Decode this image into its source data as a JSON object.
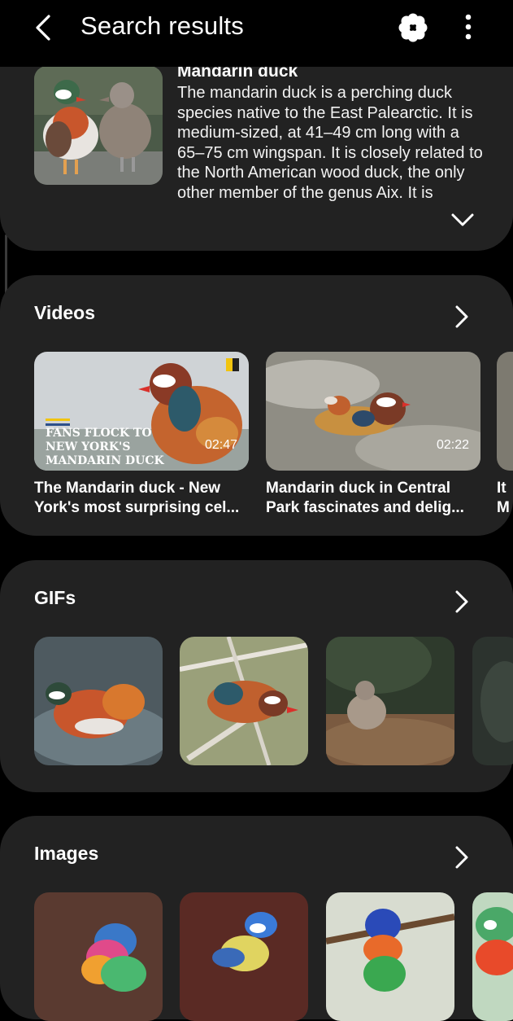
{
  "header": {
    "title": "Search results",
    "back_icon": "chevron-left-icon",
    "bixby_icon": "bixby-vision-icon",
    "more_icon": "more-vertical-icon"
  },
  "wiki": {
    "title": "Mandarin duck",
    "text": "The mandarin duck is a perching duck species native to the East Palearctic. It is medium-sized, at 41–49 cm long with a 65–75 cm wingspan. It is closely related to the North American wood duck, the only other member of the genus Aix. It is monotypic. Outside",
    "expand_icon": "chevron-down-icon"
  },
  "videos": {
    "title": "Videos",
    "items": [
      {
        "overlay_text": [
          "FANS FLOCK TO",
          "NEW YORK'S",
          "MANDARIN DUCK"
        ],
        "duration": "02:47",
        "caption_line1": "The Mandarin duck - New",
        "caption_line2": "York's most surprising cel..."
      },
      {
        "duration": "02:22",
        "caption_line1": "Mandarin duck in Central",
        "caption_line2": "Park fascinates and delig..."
      },
      {
        "caption_line1": "It",
        "caption_line2": "M"
      }
    ]
  },
  "gifs": {
    "title": "GIFs"
  },
  "images": {
    "title": "Images"
  },
  "colors": {
    "background": "#000000",
    "card": "#222222",
    "text": "#ffffff"
  }
}
